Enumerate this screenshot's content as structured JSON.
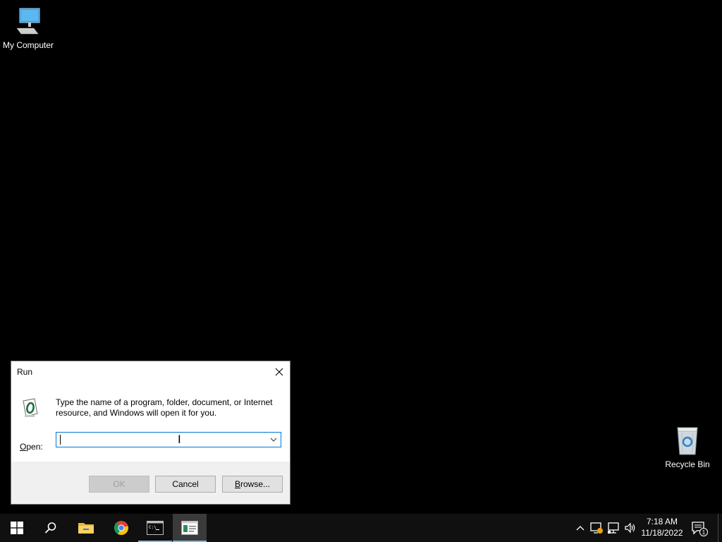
{
  "desktop": {
    "icons": [
      {
        "label": "My Computer",
        "icon": "computer-icon"
      },
      {
        "label": "Recycle Bin",
        "icon": "recycle-bin-icon"
      }
    ]
  },
  "run_dialog": {
    "title": "Run",
    "description": "Type the name of a program, folder, document, or Internet resource, and Windows will open it for you.",
    "open_label_accel": "O",
    "open_label_rest": "pen:",
    "open_value": "",
    "buttons": {
      "ok": "OK",
      "cancel": "Cancel",
      "browse_accel": "B",
      "browse_rest": "rowse..."
    },
    "ok_enabled": false
  },
  "taskbar": {
    "items": [
      {
        "name": "start",
        "icon": "windows-logo-icon"
      },
      {
        "name": "search",
        "icon": "search-icon"
      },
      {
        "name": "file-explorer",
        "icon": "folder-icon"
      },
      {
        "name": "chrome",
        "icon": "chrome-icon"
      },
      {
        "name": "command-prompt",
        "icon": "terminal-icon",
        "running": true
      },
      {
        "name": "run-window",
        "icon": "run-app-icon",
        "active": true
      }
    ],
    "tray": [
      "chevron-up-icon",
      "device-status-icon",
      "network-icon",
      "volume-icon"
    ],
    "clock": {
      "time": "7:18 AM",
      "date": "11/18/2022"
    },
    "notification_count": "1"
  },
  "colors": {
    "desktop_bg": "#000000",
    "taskbar_bg": "#101010",
    "accent": "#0078d7",
    "taskbar_indicator": "#76b9ed"
  }
}
